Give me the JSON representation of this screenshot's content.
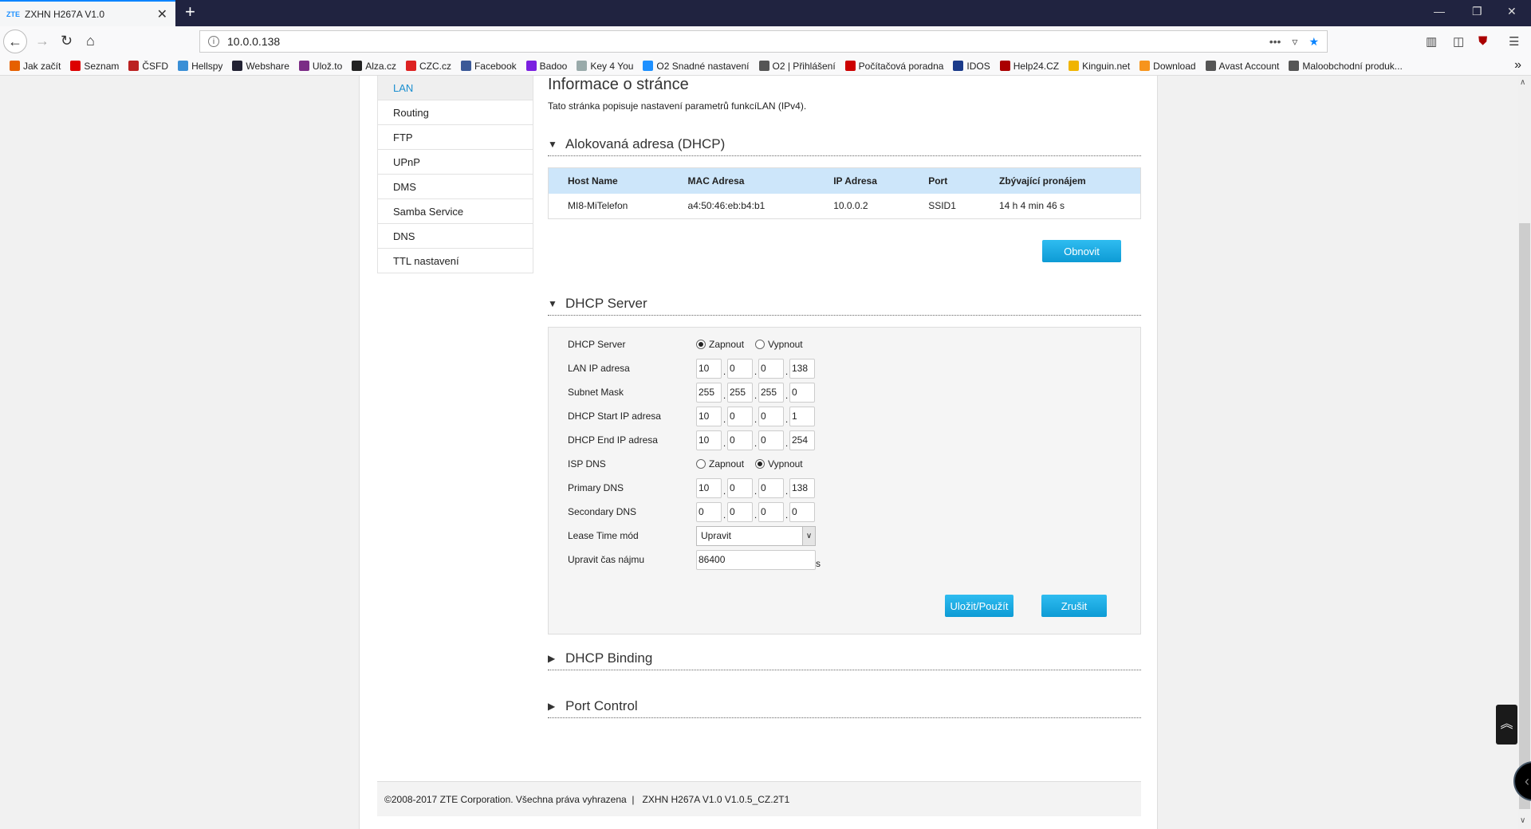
{
  "browser": {
    "tab_title": "ZXHN H267A V1.0",
    "tab_favicon": "ZTE",
    "url": "10.0.0.138",
    "bookmarks": [
      {
        "label": "Jak začít",
        "color": "#e66000"
      },
      {
        "label": "Seznam",
        "color": "#d00"
      },
      {
        "label": "ČSFD",
        "color": "#b22"
      },
      {
        "label": "Hellspy",
        "color": "#3a8fd6"
      },
      {
        "label": "Webshare",
        "color": "#223"
      },
      {
        "label": "Ulož.to",
        "color": "#7b2c86"
      },
      {
        "label": "Alza.cz",
        "color": "#222"
      },
      {
        "label": "CZC.cz",
        "color": "#d22"
      },
      {
        "label": "Facebook",
        "color": "#3b5998"
      },
      {
        "label": "Badoo",
        "color": "#7a1fe0"
      },
      {
        "label": "Key 4 You",
        "color": "#9aa"
      },
      {
        "label": "O2 Snadné nastavení",
        "color": "#1e90ff"
      },
      {
        "label": "O2 | Přihlášení",
        "color": "#555"
      },
      {
        "label": "Počítačová poradna",
        "color": "#c00"
      },
      {
        "label": "IDOS",
        "color": "#1a3a8a"
      },
      {
        "label": "Help24.CZ",
        "color": "#a00"
      },
      {
        "label": "Kinguin.net",
        "color": "#f0b400"
      },
      {
        "label": "Download",
        "color": "#f7941d"
      },
      {
        "label": "Avast Account",
        "color": "#555"
      },
      {
        "label": "Maloobchodní produk...",
        "color": "#555"
      }
    ]
  },
  "sidebar": {
    "items": [
      {
        "label": "LAN"
      },
      {
        "label": "Routing"
      },
      {
        "label": "FTP"
      },
      {
        "label": "UPnP"
      },
      {
        "label": "DMS"
      },
      {
        "label": "Samba Service"
      },
      {
        "label": "DNS"
      },
      {
        "label": "TTL nastavení"
      }
    ]
  },
  "main": {
    "title": "Informace o stránce",
    "description": "Tato stránka popisuje nastavení parametrů funkcíLAN (IPv4).",
    "dhcp_alloc": {
      "heading": "Alokovaná adresa (DHCP)",
      "columns": [
        "Host Name",
        "MAC Adresa",
        "IP Adresa",
        "Port",
        "Zbývající pronájem"
      ],
      "rows": [
        [
          "MI8-MiTelefon",
          "a4:50:46:eb:b4:b1",
          "10.0.0.2",
          "SSID1",
          "14 h 4 min 46 s"
        ]
      ],
      "refresh_label": "Obnovit"
    },
    "dhcp_server": {
      "heading": "DHCP Server",
      "server_label": "DHCP Server",
      "on_label": "Zapnout",
      "off_label": "Vypnout",
      "lan_ip_label": "LAN IP adresa",
      "lan_ip": [
        "10",
        "0",
        "0",
        "138"
      ],
      "mask_label": "Subnet Mask",
      "mask": [
        "255",
        "255",
        "255",
        "0"
      ],
      "start_label": "DHCP Start IP adresa",
      "start": [
        "10",
        "0",
        "0",
        "1"
      ],
      "end_label": "DHCP End IP adresa",
      "end": [
        "10",
        "0",
        "0",
        "254"
      ],
      "isp_dns_label": "ISP DNS",
      "primary_label": "Primary DNS",
      "primary": [
        "10",
        "0",
        "0",
        "138"
      ],
      "secondary_label": "Secondary DNS",
      "secondary": [
        "0",
        "0",
        "0",
        "0"
      ],
      "lease_mode_label": "Lease Time mód",
      "lease_mode": "Upravit",
      "lease_time_label": "Upravit čas nájmu",
      "lease_time": "86400",
      "lease_unit": "s",
      "save_label": "Uložit/Použít",
      "cancel_label": "Zrušit"
    },
    "dhcp_binding_heading": "DHCP Binding",
    "port_control_heading": "Port Control"
  },
  "footer": {
    "copyright": "©2008-2017 ZTE Corporation. Všechna práva vyhrazena",
    "separator": "|",
    "version": "ZXHN H267A V1.0 V1.0.5_CZ.2T1"
  }
}
